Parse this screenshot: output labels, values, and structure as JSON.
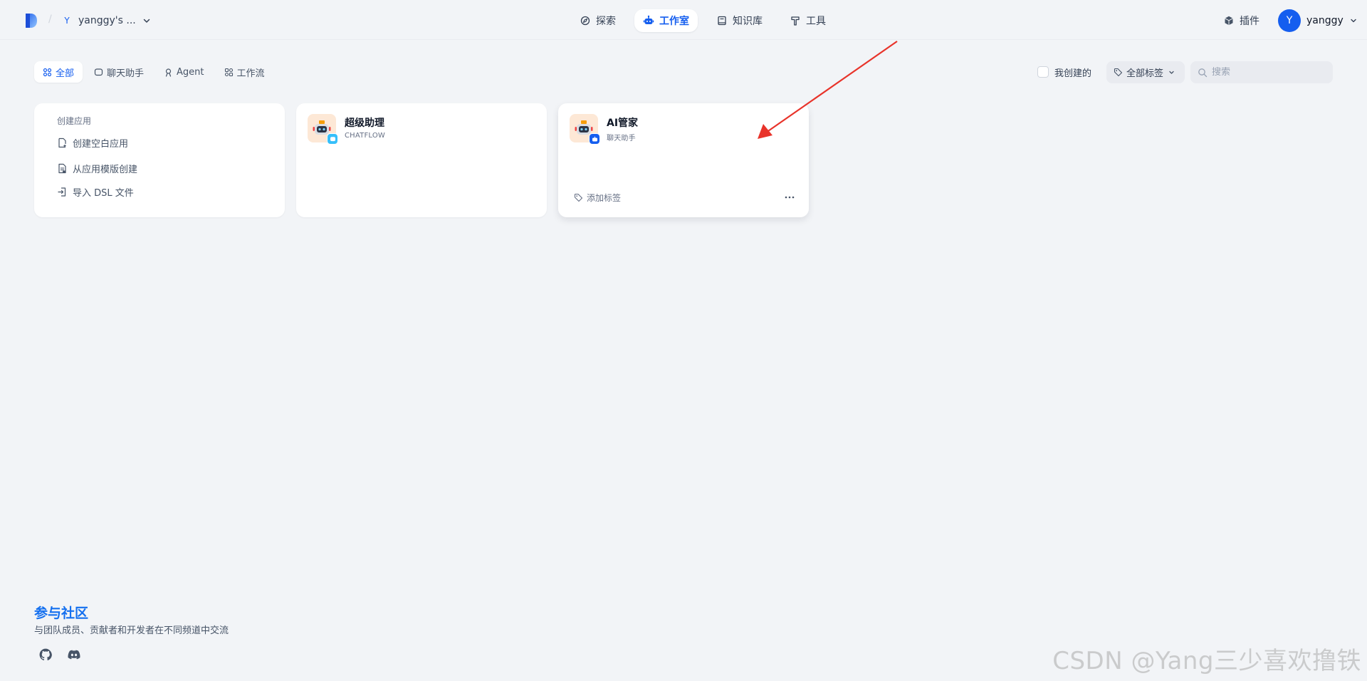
{
  "header": {
    "workspace_initial": "Y",
    "workspace_name": "yanggy's ...",
    "nav": [
      {
        "label": "探索",
        "icon": "compass-icon",
        "active": false
      },
      {
        "label": "工作室",
        "icon": "robot-icon",
        "active": true
      },
      {
        "label": "知识库",
        "icon": "book-icon",
        "active": false
      },
      {
        "label": "工具",
        "icon": "hammer-icon",
        "active": false
      }
    ],
    "plugin_label": "插件",
    "user_initial": "Y",
    "user_name": "yanggy"
  },
  "toolbar": {
    "tabs": [
      {
        "label": "全部",
        "active": true
      },
      {
        "label": "聊天助手",
        "active": false
      },
      {
        "label": "Agent",
        "active": false
      },
      {
        "label": "工作流",
        "active": false
      }
    ],
    "mine_label": "我创建的",
    "tags_label": "全部标签",
    "search_placeholder": "搜索"
  },
  "create_card": {
    "title": "创建应用",
    "items": [
      "创建空白应用",
      "从应用模版创建",
      "导入 DSL 文件"
    ]
  },
  "apps": [
    {
      "name": "超级助理",
      "type": "CHATFLOW",
      "badge_color": "#36bffa",
      "show_footer": false
    },
    {
      "name": "AI管家",
      "type": "聊天助手",
      "badge_color": "#155eef",
      "show_footer": true,
      "add_tag_label": "添加标签"
    }
  ],
  "footer": {
    "title": "参与社区",
    "description": "与团队成员、贡献者和开发者在不同频道中交流"
  },
  "watermark": "CSDN @Yang三少喜欢撸铁",
  "colors": {
    "accent": "#155eef",
    "community": "#1570ef",
    "annotation_arrow": "#e8332a"
  }
}
